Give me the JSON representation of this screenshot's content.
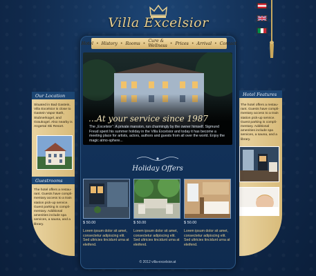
{
  "brand": {
    "name": "Villa Excelsior"
  },
  "nav": {
    "items": [
      {
        "label": "Hotel"
      },
      {
        "label": "History"
      },
      {
        "label": "Rooms"
      },
      {
        "label": "Cure & Wellness"
      },
      {
        "label": "Prices"
      },
      {
        "label": "Arrival"
      },
      {
        "label": "Contact"
      }
    ],
    "separator": "•"
  },
  "hero": {
    "tagline": "...At your service since 1987",
    "text": "The „Excelsior“: A private mansion, run charmingly by the owner himself. Sigmund Freud spent his summer holiday in the Villa Excelsior and today it has become a meeting place for artists, actors, authors and guests from all over the world. Enjoy the magic atmo-sphere..."
  },
  "left": {
    "location_title": "Our Location",
    "location_text": "Situated in Bad Gastein, Villa Excelsior is close to Gastein Vapor Bath, Stubnerkogel, and Graukogel. Also nearby is Angertal Ski Resort.",
    "guestrooms_title": "Guestrooms",
    "guestrooms_text": "The hotel offers a restau-rant. Guests have compli-mentary access to a train station pick-up service. Guest parking is compli-mentary. Additional amenities include spa services, a sauna, and a library."
  },
  "right": {
    "features_title": "Hotel Features",
    "features_text": "The hotel offers a restau-rant. Guests have compli-mentary access to a train station pick-up service. Guest parking is compli-mentary. Additional amenities include spa services, a sauna, and a library."
  },
  "offers": {
    "title": "Holiday Offers",
    "items": [
      {
        "price": "$ 50.00",
        "desc": "Lorem ipsum dolor sit amet, consectetur adipiscing elit. Sed ultricies tincidunt urna at eleifend."
      },
      {
        "price": "$ 50.00",
        "desc": "Lorem ipsum dolor sit amet, consectetur adipiscing elit. Sed ultricies tincidunt urna at eleifend."
      },
      {
        "price": "$ 50.00",
        "desc": "Lorem ipsum dolor sit amet, consectetur adipiscing elit. Sed ultricies tincidunt urna at eleifend."
      }
    ]
  },
  "footer": {
    "text": "© 2012 villa-excelsior.at"
  },
  "flags": [
    {
      "icon": "austria-flag-icon"
    },
    {
      "icon": "uk-flag-icon"
    },
    {
      "icon": "italy-flag-icon"
    }
  ],
  "colors": {
    "navy": "#0f2a4e",
    "gold": "#e8cf8f",
    "panel": "#e0c58a",
    "header_blue": "#1c4572"
  }
}
